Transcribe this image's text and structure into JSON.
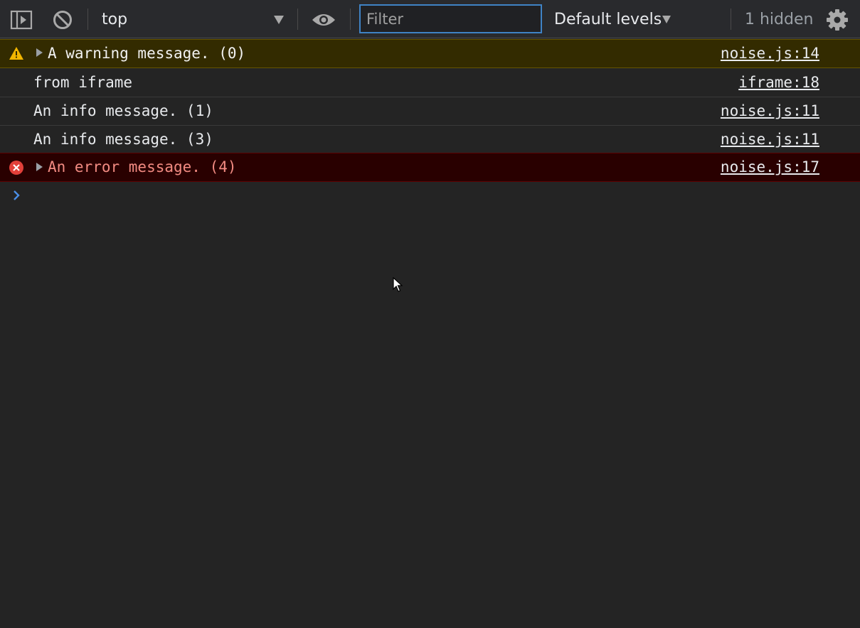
{
  "toolbar": {
    "context": "top",
    "filter_placeholder": "Filter",
    "levels_label": "Default levels",
    "hidden_label": "1 hidden"
  },
  "icons": {
    "sidebar": "sidebar-toggle-icon",
    "clear": "clear-console-icon",
    "eye": "eye-icon",
    "settings": "gear-icon",
    "warning": "warning-icon",
    "error": "error-icon",
    "prompt": "chevron-right-icon"
  },
  "colors": {
    "warning_bg": "#332b00",
    "error_bg": "#290000",
    "error_text": "#f28b82",
    "accent": "#3f83c5"
  },
  "messages": [
    {
      "type": "warning",
      "text": "A warning message. (0)",
      "source": "noise.js:14"
    },
    {
      "type": "log",
      "text": "from iframe",
      "source": "iframe:18"
    },
    {
      "type": "log",
      "text": "An info message. (1)",
      "source": "noise.js:11"
    },
    {
      "type": "log",
      "text": "An info message. (3)",
      "source": "noise.js:11"
    },
    {
      "type": "error",
      "text": "An error message. (4)",
      "source": "noise.js:17"
    }
  ]
}
